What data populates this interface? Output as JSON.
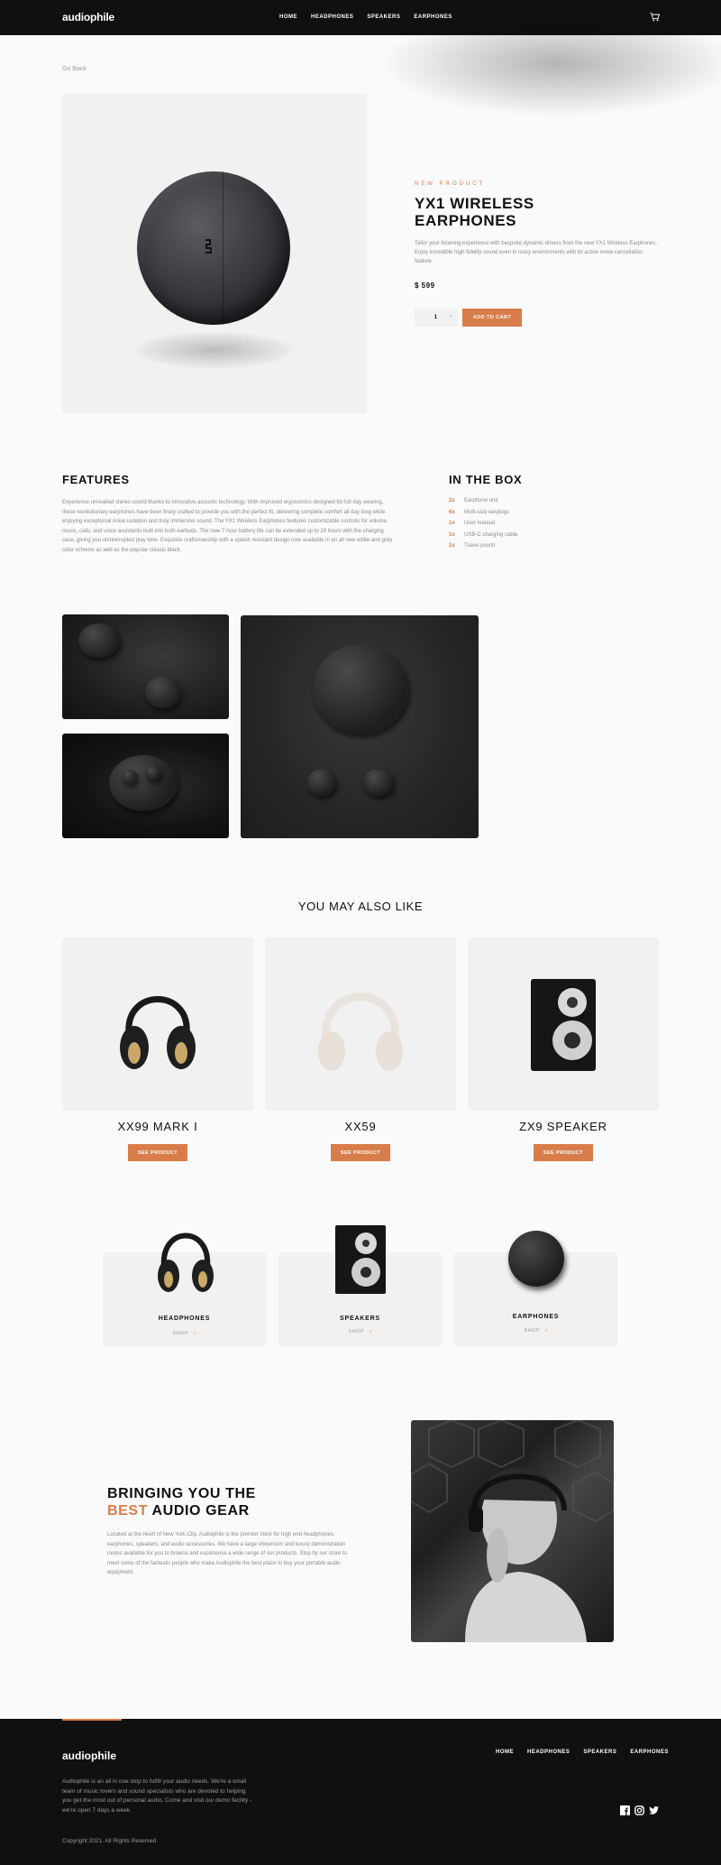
{
  "header": {
    "logo": "audiophile",
    "nav": [
      "HOME",
      "HEADPHONES",
      "SPEAKERS",
      "EARPHONES"
    ]
  },
  "go_back": "Go Back",
  "product": {
    "overline": "NEW PRODUCT",
    "title": "YX1 WIRELESS EARPHONES",
    "description": "Tailor your listening experience with bespoke dynamic drivers from the new YX1 Wireless Earphones. Enjoy incredible high-fidelity sound even in noisy environments with its active noise cancellation feature.",
    "price": "$ 599",
    "quantity": {
      "minus": "-",
      "value": "1",
      "plus": "+"
    },
    "add_to_cart": "ADD TO CART"
  },
  "features": {
    "heading": "FEATURES",
    "text": "Experience unrivalled stereo sound thanks to innovative acoustic technology. With improved ergonomics designed for full day wearing, these revolutionary earphones have been finely crafted to provide you with the perfect fit, delivering complete comfort all day long while enjoying exceptional noise isolation and truly immersive sound. The YX1 Wireless Earphones features customizable controls for volume, music, calls, and voice assistants built into both earbuds. The new 7-hour battery life can be extended up to 28 hours with the charging case, giving you uninterrupted play time. Exquisite craftsmanship with a splash resistant design now available in an all new white and grey color scheme as well as the popular classic black."
  },
  "in_the_box": {
    "heading": "IN THE BOX",
    "items": [
      {
        "qty": "2x",
        "name": "Earphone unit"
      },
      {
        "qty": "6x",
        "name": "Multi-size earplugs"
      },
      {
        "qty": "1x",
        "name": "User manual"
      },
      {
        "qty": "1x",
        "name": "USB-C charging cable"
      },
      {
        "qty": "1x",
        "name": "Travel pouch"
      }
    ]
  },
  "also_like": {
    "heading": "YOU MAY ALSO LIKE",
    "items": [
      {
        "name": "XX99 MARK I",
        "button": "SEE PRODUCT"
      },
      {
        "name": "XX59",
        "button": "SEE PRODUCT"
      },
      {
        "name": "ZX9 SPEAKER",
        "button": "SEE PRODUCT"
      }
    ]
  },
  "categories": [
    {
      "name": "HEADPHONES",
      "shop": "SHOP",
      "arrow": "›"
    },
    {
      "name": "SPEAKERS",
      "shop": "SHOP",
      "arrow": "›"
    },
    {
      "name": "EARPHONES",
      "shop": "SHOP",
      "arrow": "›"
    }
  ],
  "about": {
    "heading_line1": "BRINGING YOU THE",
    "heading_accent": "BEST",
    "heading_rest": "AUDIO GEAR",
    "text": "Located at the heart of New York City, Audiophile is the premier store for high end headphones, earphones, speakers, and audio accessories. We have a large showroom and luxury demonstration rooms available for you to browse and experience a wide range of our products. Stop by our store to meet some of the fantastic people who make Audiophile the best place to buy your portable audio equipment."
  },
  "footer": {
    "logo": "audiophile",
    "nav": [
      "HOME",
      "HEADPHONES",
      "SPEAKERS",
      "EARPHONES"
    ],
    "description": "Audiophile is an all in one stop to fulfill your audio needs. We're a small team of music lovers and sound specialists who are devoted to helping you get the most out of personal audio. Come and visit our demo facility - we're open 7 days a week.",
    "copyright": "Copyright 2021. All Rights Reserved",
    "social": [
      "facebook-icon",
      "instagram-icon",
      "twitter-icon"
    ]
  },
  "colors": {
    "accent": "#D87D4A",
    "dark": "#101010",
    "light_bg": "#F1F1F1",
    "page_bg": "#FAFAFA"
  }
}
